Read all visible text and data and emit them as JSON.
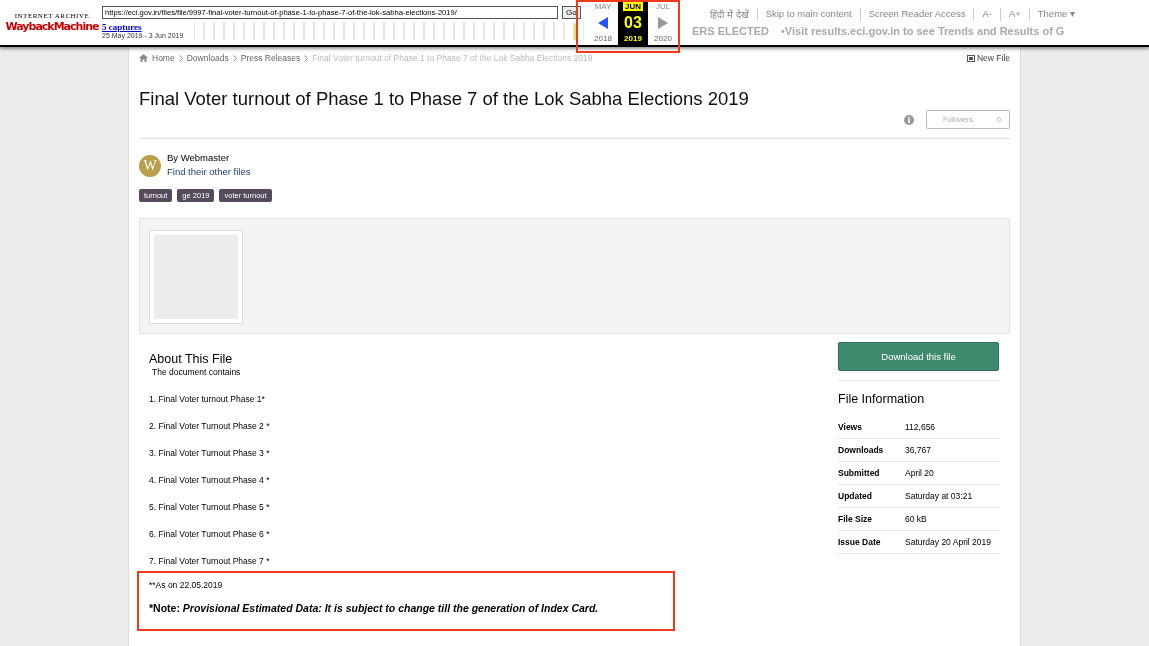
{
  "wayback": {
    "logo_top": "INTERNET ARCHIVE",
    "logo_main": "WaybackMachine",
    "url": "https://eci.gov.in/files/file/9997-final-voter-turnout-of-phase-1-to-phase-7-of-the-lok-sabha-elections-2019/",
    "go": "Go",
    "captures": "5 captures",
    "capture_range": "25 May 2019 - 3 Jun 2019",
    "months": [
      {
        "label": "MAY",
        "selected": false
      },
      {
        "label": "JUN",
        "selected": true
      },
      {
        "label": "JUL",
        "selected": false
      }
    ],
    "day": "03",
    "years": [
      {
        "label": "2018",
        "selected": false
      },
      {
        "label": "2019",
        "selected": true
      },
      {
        "label": "2020",
        "selected": false
      }
    ]
  },
  "site_header": {
    "links": [
      "हिंदी में देखें",
      "Skip to main content",
      "Screen Reader Access",
      "A-",
      "A+",
      "Theme ▾"
    ],
    "ticker": [
      "ERS ELECTED",
      "•Visit results.eci.gov.in to see Trends and Results of G"
    ]
  },
  "breadcrumb": [
    "Home",
    "Downloads",
    "Press Releases",
    "Final Voter turnout of Phase 1 to Phase 7 of the Lok Sabha Elections 2019"
  ],
  "new_file": "New File",
  "title": "Final Voter turnout of Phase 1 to Phase 7 of the Lok Sabha Elections 2019",
  "followers": {
    "label": "Followers",
    "count": "0"
  },
  "author": {
    "avatar": "W",
    "by": "By Webmaster",
    "link": "Find their other files"
  },
  "tags": [
    "turnout",
    "ge 2019",
    "voter turnout"
  ],
  "about": {
    "heading": "About This File",
    "intro": "The document contains",
    "items": [
      "1. Final Voter turnout Phase 1*",
      "2. Final Voter Turnout Phase 2 *",
      "3. Final Voter Turnout Phase 3 *",
      "4. Final Voter Turnout Phase 4 *",
      "5. Final Voter Turnout Phase 5 *",
      "6. Final Voter Turnout Phase 6 *",
      "7. Final Voter Turnout Phase 7 *"
    ],
    "as_on": "**As on 22.05.2019",
    "note": {
      "label": "*Note:",
      "text": "Provisional Estimated Data: It is subject to change till the generation of Index Card."
    }
  },
  "download_button": "Download this file",
  "file_info": {
    "heading": "File Information",
    "rows": [
      {
        "label": "Views",
        "value": "112,656"
      },
      {
        "label": "Downloads",
        "value": "36,767"
      },
      {
        "label": "Submitted",
        "value": "April 20"
      },
      {
        "label": "Updated",
        "value": "Saturday at 03:21"
      },
      {
        "label": "File Size",
        "value": "60 kB"
      },
      {
        "label": "Issue Date",
        "value": "Saturday 20 April 2019"
      }
    ]
  }
}
